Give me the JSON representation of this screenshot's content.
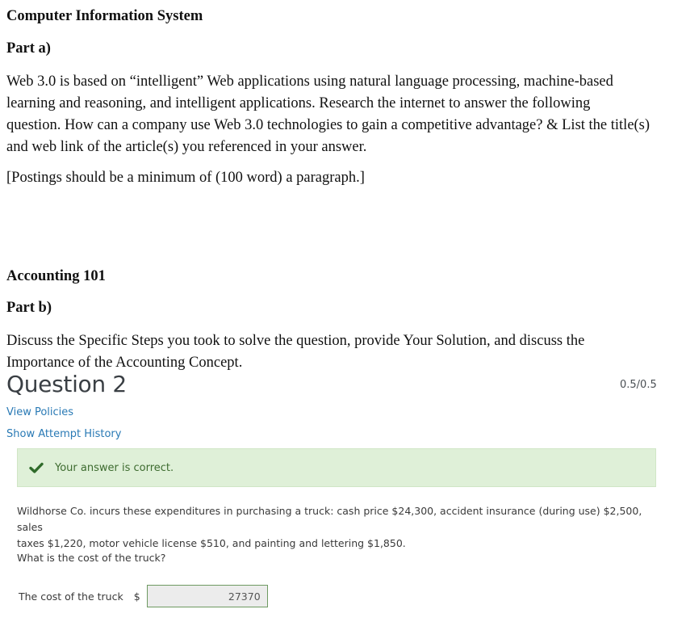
{
  "sections": {
    "cis": {
      "title": "Computer Information System",
      "part_label": "Part a)",
      "prompt_lines": [
        "Web 3.0 is based on “intelligent” Web applications using natural language processing, machine-based",
        "learning and reasoning, and intelligent applications. Research the internet to answer the following",
        "question. How can a company use Web 3.0 technologies to gain a competitive advantage? & List the title(s)",
        "and web link of the article(s) you referenced in your answer."
      ],
      "note": "[Postings should be a minimum of (100 word) a paragraph.]"
    },
    "accounting": {
      "title": "Accounting 101",
      "part_label": "Part b)",
      "prompt_lines": [
        "Discuss the Specific Steps you took to solve the question, provide Your Solution, and discuss the",
        "Importance of the Accounting Concept."
      ]
    }
  },
  "question": {
    "title": "Question 2",
    "score": "0.5/0.5",
    "links": {
      "view_policies": "View Policies",
      "show_attempt_history": "Show Attempt History"
    },
    "feedback": {
      "icon": "checkmark-icon",
      "message": "Your answer is correct.",
      "color": "#3d6b2f",
      "background": "#dff0d8"
    },
    "text_lines": [
      "Wildhorse Co. incurs these expenditures in purchasing a truck: cash price $24,300, accident insurance (during use) $2,500, sales",
      "taxes $1,220, motor vehicle license $510, and painting and lettering $1,850."
    ],
    "ask": "What is the cost of the truck?",
    "answer": {
      "label": "The cost of the truck",
      "currency": "$",
      "value": "27370"
    }
  }
}
